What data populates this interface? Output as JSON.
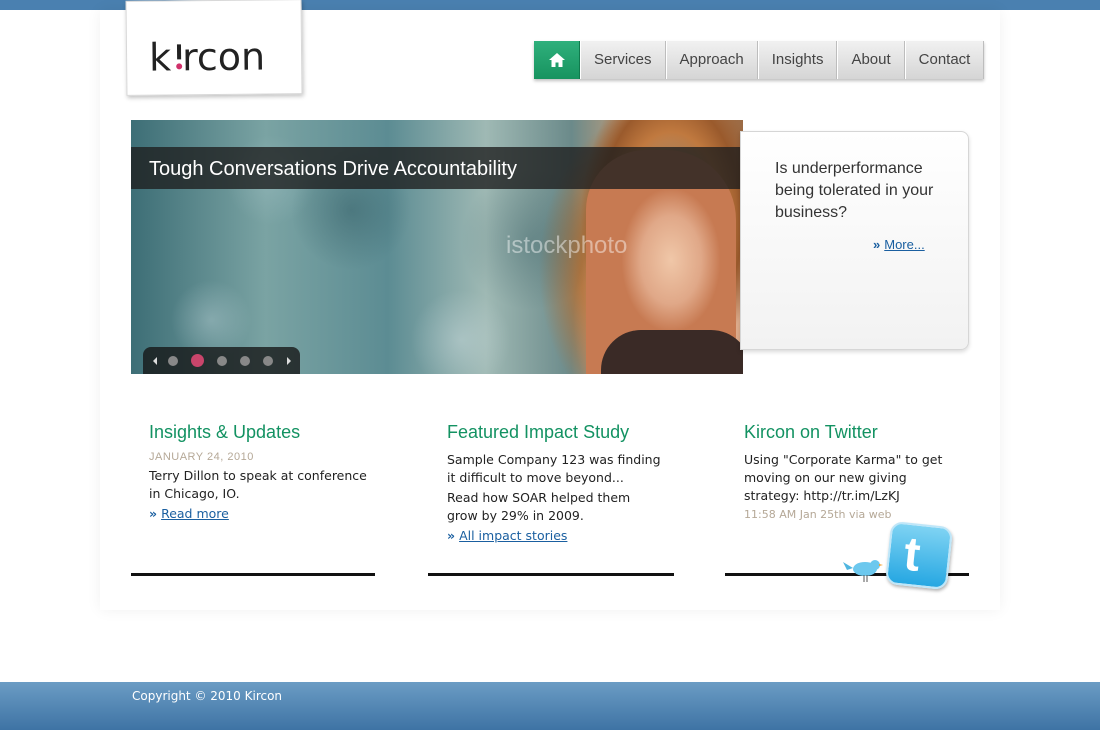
{
  "brand": {
    "logo_text": "kircon",
    "accent_color": "#139262",
    "dot_color": "#d0306a"
  },
  "nav": {
    "home_icon": "home-icon",
    "items": [
      "Services",
      "Approach",
      "Insights",
      "About",
      "Contact"
    ]
  },
  "hero": {
    "caption": "Tough Conversations Drive Accountability",
    "watermark": "istockphoto",
    "slide_count": 5,
    "active_slide": 2
  },
  "promo": {
    "text": "Is underperformance being tolerated in your business?",
    "more_label": "More..."
  },
  "columns": {
    "insights": {
      "title": "Insights & Updates",
      "date": "JANUARY 24, 2010",
      "text": "Terry Dillon to speak at conference in Chicago, IO.",
      "link": "Read more"
    },
    "impact": {
      "title": "Featured Impact Study",
      "text1": "Sample Company 123 was finding it difficult to move beyond...",
      "text2": "Read how SOAR helped them grow by 29% in 2009.",
      "link": "All impact stories"
    },
    "twitter": {
      "title": "Kircon on Twitter",
      "tweet": "Using \"Corporate Karma\" to get moving on our new giving strategy: http://tr.im/LzKJ",
      "meta": "11:58 AM Jan 25th via web",
      "badge_icon": "twitter-icon",
      "bird_icon": "twitter-bird-icon"
    }
  },
  "footer": {
    "copyright": "Copyright © 2010 Kircon"
  }
}
